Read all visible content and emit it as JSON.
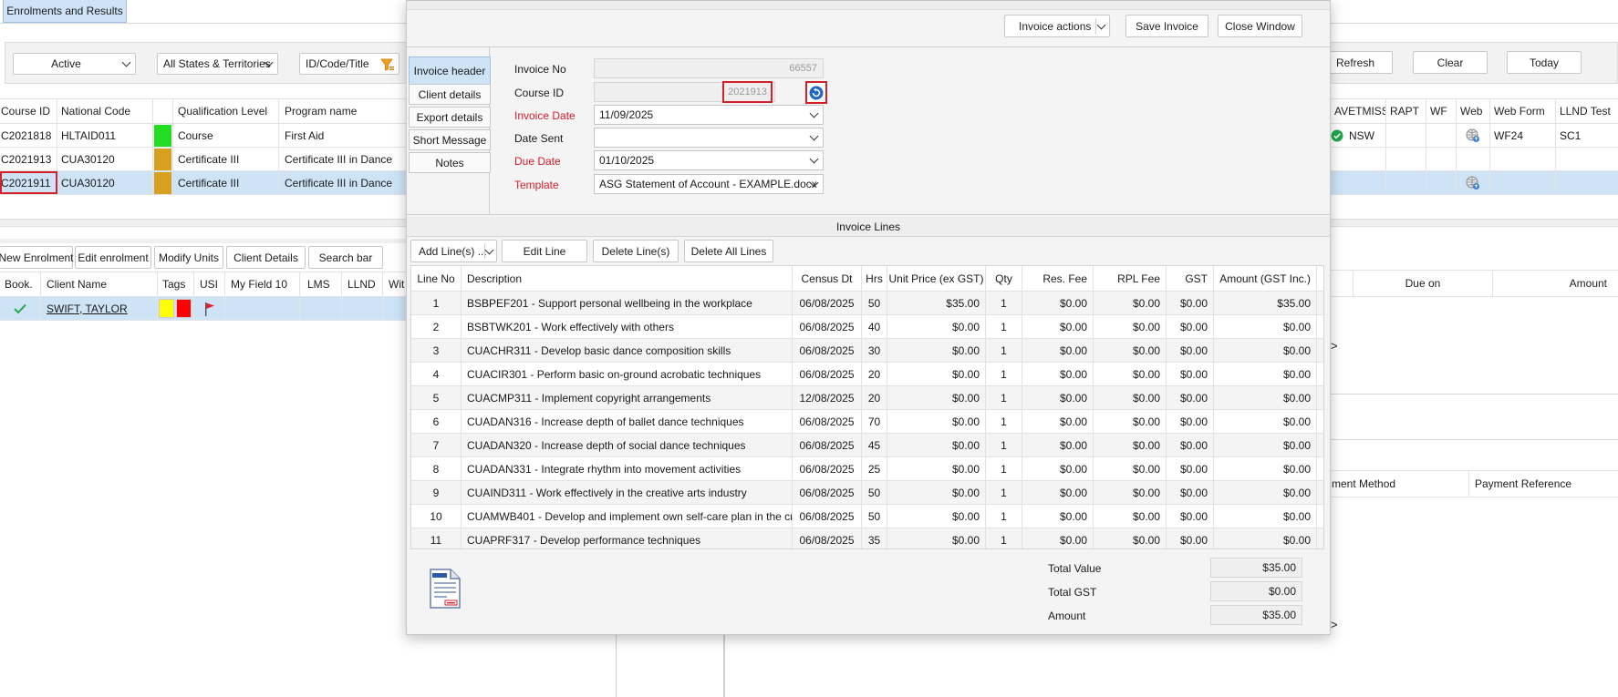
{
  "main": {
    "tab_label": "Enrolments and Results",
    "filters": {
      "status": "Active",
      "states": "All States & Territories",
      "search_placeholder": "ID/Code/Title"
    },
    "right_buttons": {
      "refresh": "Refresh",
      "clear": "Clear",
      "today": "Today"
    },
    "course_columns": [
      "Course ID",
      "National Code",
      "",
      "Qualification Level",
      "Program name"
    ],
    "courses": [
      {
        "id": "C2021818",
        "code": "HLTAID011",
        "color": "#22dd22",
        "level": "Course",
        "program": "First Aid"
      },
      {
        "id": "C2021913",
        "code": "CUA30120",
        "color": "#d8a020",
        "level": "Certificate III",
        "program": "Certificate III in Dance"
      },
      {
        "id": "C2021911",
        "code": "CUA30120",
        "color": "#d8a020",
        "level": "Certificate III",
        "program": "Certificate III in Dance"
      }
    ],
    "right_columns": [
      "AVETMISS",
      "RAPT",
      "WF",
      "Web",
      "Web Form",
      "LLND Test"
    ],
    "right_row1": {
      "state": "NSW",
      "web_form": "WF24",
      "llnd": "SC1"
    },
    "enrol_buttons": [
      "New Enrolment",
      "Edit enrolment",
      "Modify Units",
      "Client Details",
      "Search bar"
    ],
    "client_columns": [
      "Book.",
      "Client Name",
      "Tags",
      "USI",
      "My Field 10",
      "LMS",
      "LLND",
      "Wit"
    ],
    "client_row": {
      "name": "SWIFT, TAYLOR"
    },
    "right_lower_columns": {
      "due_on": "Due on",
      "amount": "Amount"
    },
    "payment_columns": {
      "method": "ment Method",
      "reference": "Payment Reference"
    },
    "stray_glyph": ">"
  },
  "dialog": {
    "top_buttons": {
      "invoice_actions": "Invoice actions",
      "save": "Save Invoice",
      "close": "Close Window"
    },
    "tabs": [
      "Invoice header",
      "Client details",
      "Export details",
      "Short Message",
      "Notes"
    ],
    "labels": {
      "invoice_no": "Invoice No",
      "course_id": "Course ID",
      "invoice_date": "Invoice Date",
      "date_sent": "Date Sent",
      "due_date": "Due Date",
      "template": "Template"
    },
    "values": {
      "invoice_no": "66557",
      "course_id": "2021913",
      "invoice_date": "11/09/2025",
      "date_sent": "",
      "due_date": "01/10/2025",
      "template": "ASG Statement of Account - EXAMPLE.docx"
    },
    "invoice_lines_title": "Invoice Lines",
    "line_buttons": {
      "add": "Add Line(s) ...",
      "edit": "Edit Line",
      "delete": "Delete Line(s)",
      "delete_all": "Delete All Lines"
    },
    "line_columns": [
      "Line No",
      "Description",
      "Census Dt",
      "Hrs",
      "Unit Price (ex GST)",
      "Qty",
      "Res. Fee",
      "RPL Fee",
      "GST",
      "Amount (GST Inc.)"
    ],
    "lines": [
      {
        "no": "1",
        "desc": "BSBPEF201 - Support personal wellbeing in the workplace",
        "census": "06/08/2025",
        "hrs": "50",
        "price": "$35.00",
        "qty": "1",
        "res": "$0.00",
        "rpl": "$0.00",
        "gst": "$0.00",
        "amount": "$35.00"
      },
      {
        "no": "2",
        "desc": "BSBTWK201 - Work effectively with others",
        "census": "06/08/2025",
        "hrs": "40",
        "price": "$0.00",
        "qty": "1",
        "res": "$0.00",
        "rpl": "$0.00",
        "gst": "$0.00",
        "amount": "$0.00"
      },
      {
        "no": "3",
        "desc": "CUACHR311 - Develop basic dance composition skills",
        "census": "06/08/2025",
        "hrs": "30",
        "price": "$0.00",
        "qty": "1",
        "res": "$0.00",
        "rpl": "$0.00",
        "gst": "$0.00",
        "amount": "$0.00"
      },
      {
        "no": "4",
        "desc": "CUACIR301 - Perform basic on-ground acrobatic techniques",
        "census": "06/08/2025",
        "hrs": "20",
        "price": "$0.00",
        "qty": "1",
        "res": "$0.00",
        "rpl": "$0.00",
        "gst": "$0.00",
        "amount": "$0.00"
      },
      {
        "no": "5",
        "desc": "CUACMP311 - Implement copyright arrangements",
        "census": "12/08/2025",
        "hrs": "20",
        "price": "$0.00",
        "qty": "1",
        "res": "$0.00",
        "rpl": "$0.00",
        "gst": "$0.00",
        "amount": "$0.00"
      },
      {
        "no": "6",
        "desc": "CUADAN316 - Increase depth of ballet dance techniques",
        "census": "06/08/2025",
        "hrs": "70",
        "price": "$0.00",
        "qty": "1",
        "res": "$0.00",
        "rpl": "$0.00",
        "gst": "$0.00",
        "amount": "$0.00"
      },
      {
        "no": "7",
        "desc": "CUADAN320 - Increase depth of social dance techniques",
        "census": "06/08/2025",
        "hrs": "45",
        "price": "$0.00",
        "qty": "1",
        "res": "$0.00",
        "rpl": "$0.00",
        "gst": "$0.00",
        "amount": "$0.00"
      },
      {
        "no": "8",
        "desc": "CUADAN331 - Integrate rhythm into movement activities",
        "census": "06/08/2025",
        "hrs": "25",
        "price": "$0.00",
        "qty": "1",
        "res": "$0.00",
        "rpl": "$0.00",
        "gst": "$0.00",
        "amount": "$0.00"
      },
      {
        "no": "9",
        "desc": "CUAIND311 - Work effectively in the creative arts industry",
        "census": "06/08/2025",
        "hrs": "50",
        "price": "$0.00",
        "qty": "1",
        "res": "$0.00",
        "rpl": "$0.00",
        "gst": "$0.00",
        "amount": "$0.00"
      },
      {
        "no": "10",
        "desc": "CUAMWB401 - Develop and implement own self-care plan in the creative i",
        "census": "06/08/2025",
        "hrs": "50",
        "price": "$0.00",
        "qty": "1",
        "res": "$0.00",
        "rpl": "$0.00",
        "gst": "$0.00",
        "amount": "$0.00"
      },
      {
        "no": "11",
        "desc": "CUAPRF317 - Develop performance techniques",
        "census": "06/08/2025",
        "hrs": "35",
        "price": "$0.00",
        "qty": "1",
        "res": "$0.00",
        "rpl": "$0.00",
        "gst": "$0.00",
        "amount": "$0.00"
      }
    ],
    "totals": {
      "total_value_label": "Total Value",
      "total_value": "$35.00",
      "total_gst_label": "Total GST",
      "total_gst": "$0.00",
      "amount_label": "Amount",
      "amount": "$35.00"
    }
  },
  "colors": {
    "accent": "#cfe3f7",
    "required_label": "#d4202a",
    "highlight_border": "#d4202a",
    "icon_blue": "#1e66c8"
  }
}
